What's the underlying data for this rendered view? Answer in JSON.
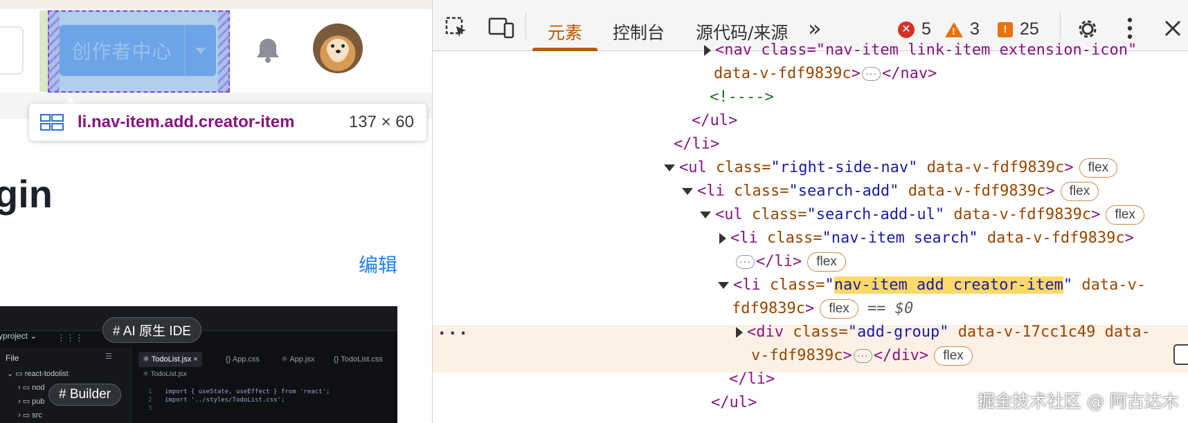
{
  "page": {
    "creator_button_label": "创作者中心",
    "tooltip": {
      "selector": "li.nav-item.add.creator-item",
      "size": "137 × 60"
    },
    "heading_fragment": "gin",
    "edit_link": "编辑",
    "ide": {
      "badge_top": "# AI 原生 IDE",
      "badge_bottom": "# Builder",
      "project_label": "yproject ⌄",
      "sidebar_header": "File",
      "sidebar_items": [
        "react-todolist",
        "nod",
        "pub",
        "src"
      ],
      "tabs": [
        "TodoList.jsx",
        "App.css",
        "App.jsx",
        "TodoList.css"
      ],
      "breadcrumb": "TodoList.jsx",
      "code_lines": [
        {
          "n": "1",
          "text": "import { useState, useEffect } from 'react';"
        },
        {
          "n": "2",
          "text": "import '../styles/TodoList.css';"
        },
        {
          "n": "3",
          "text": ""
        }
      ]
    }
  },
  "devtools": {
    "tabs": [
      "元素",
      "控制台",
      "源代码/来源"
    ],
    "active_tab": "元素",
    "more_tabs_glyph": "»",
    "counters": {
      "errors": "5",
      "warnings": "3",
      "issues": "25"
    },
    "dom": {
      "r0": "<nav class=\"nav-item link-item extension-icon\"",
      "r1_attr": "data-v-fdf9839c",
      "r1_close": "</nav>",
      "r2_comment": "<!---->",
      "r3": "</ul>",
      "r4": "</li>",
      "r5_tag": "ul",
      "r5_class": "\"right-side-nav\"",
      "r5_data": "data-v-fdf9839c",
      "r6_tag": "li",
      "r6_class": "\"search-add\"",
      "r6_data": "data-v-fdf9839c",
      "r7_tag": "ul",
      "r7_class": "\"search-add-ul\"",
      "r7_data": "data-v-fdf9839c",
      "r8_tag": "li",
      "r8_class": "\"nav-item search\"",
      "r8_data": "data-v-fdf9839c",
      "r9_close": "</li>",
      "r10_tag": "li",
      "r10_class_hit": "nav-item add creator-item",
      "r10_data": "data-v-",
      "r11_data": "fdf9839c",
      "r11_eq": "== $0",
      "r12_tag": "div",
      "r12_class": "\"add-group\"",
      "r12_data": "data-v-17cc1c49 data-",
      "r13_data": "v-fdf9839c",
      "r13_close": "</div>",
      "r14": "</li>",
      "r15": "</ul>",
      "badge": "flex",
      "class_attr": "class="
    }
  },
  "watermark": "掘金技术社区 @ 阿古达木",
  "colors": {
    "creator_button": "#6aa0f5",
    "highlight_overlay": "#6fa8dc",
    "tooltip_selector": "#881280",
    "devtools_active_tab": "#b75a00",
    "selected_row_bg": "#fdf1e6",
    "match_highlight": "#ffd966"
  }
}
